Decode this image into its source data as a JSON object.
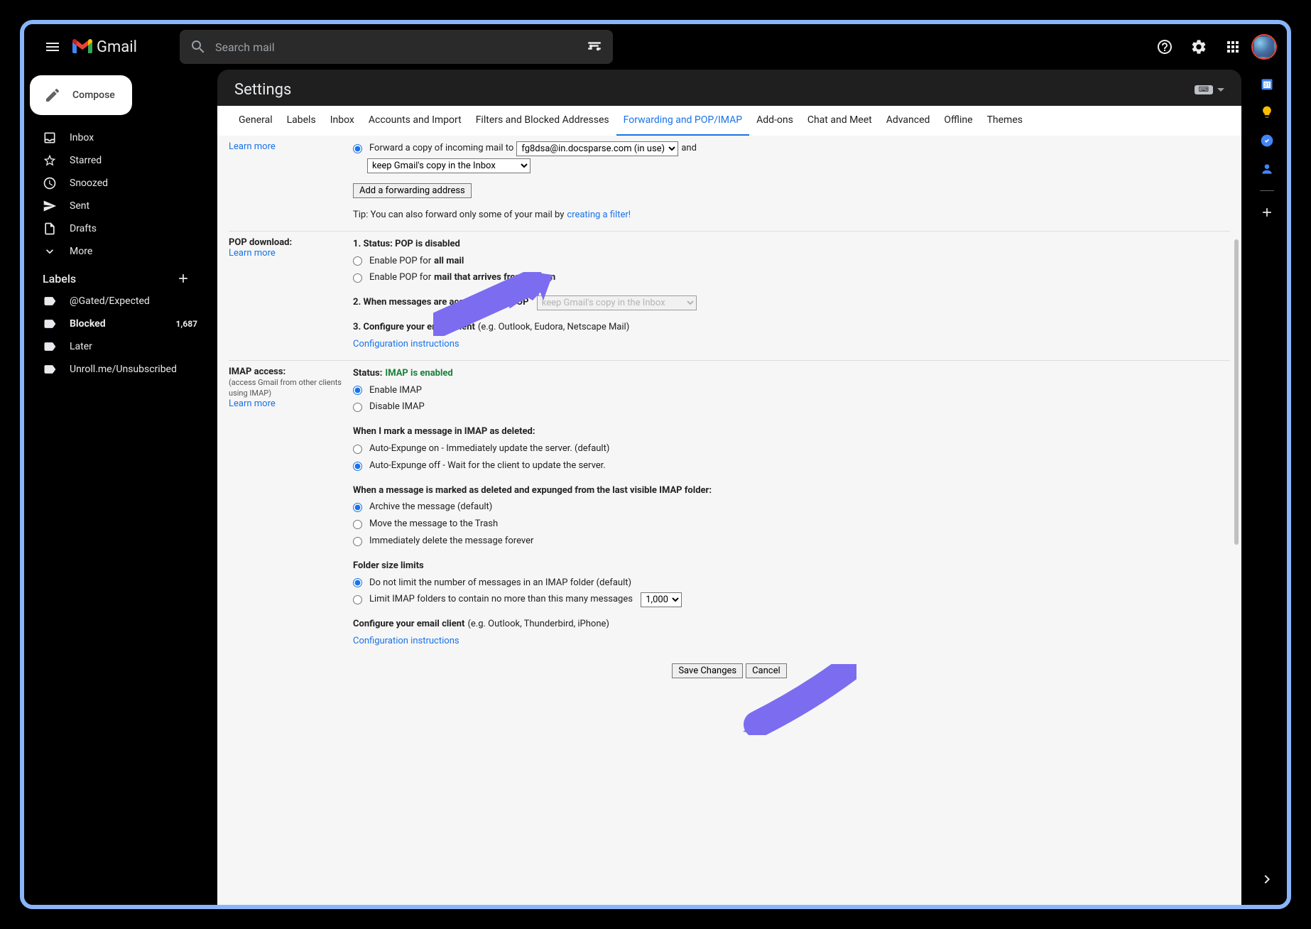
{
  "header": {
    "logo_text": "Gmail",
    "search_placeholder": "Search mail"
  },
  "sidebar": {
    "compose": "Compose",
    "items": [
      {
        "label": "Inbox"
      },
      {
        "label": "Starred"
      },
      {
        "label": "Snoozed"
      },
      {
        "label": "Sent"
      },
      {
        "label": "Drafts"
      },
      {
        "label": "More"
      }
    ],
    "labels_title": "Labels",
    "labels": [
      {
        "label": "@Gated/Expected",
        "bold": false,
        "count": ""
      },
      {
        "label": "Blocked",
        "bold": true,
        "count": "1,687"
      },
      {
        "label": "Later",
        "bold": false,
        "count": ""
      },
      {
        "label": "Unroll.me/Unsubscribed",
        "bold": false,
        "count": ""
      }
    ]
  },
  "settings": {
    "title": "Settings",
    "input_indicator": "⌨",
    "tabs": [
      "General",
      "Labels",
      "Inbox",
      "Accounts and Import",
      "Filters and Blocked Addresses",
      "Forwarding and POP/IMAP",
      "Add-ons",
      "Chat and Meet",
      "Advanced",
      "Offline",
      "Themes"
    ],
    "active_tab": "Forwarding and POP/IMAP"
  },
  "forwarding": {
    "learn_more": "Learn more",
    "radio_label": "Forward a copy of incoming mail to",
    "address": "fg8dsa@in.docsparse.com (in use)",
    "and": "and",
    "action": "keep Gmail's copy in the Inbox",
    "add_button": "Add a forwarding address",
    "tip_prefix": "Tip: You can also forward only some of your mail by ",
    "tip_link": "creating a filter!"
  },
  "pop": {
    "title": "POP download:",
    "learn_more": "Learn more",
    "status_prefix": "1. Status: ",
    "status": "POP is disabled",
    "enable_all_prefix": "Enable POP for ",
    "enable_all_bold": "all mail",
    "enable_now_prefix": "Enable POP for ",
    "enable_now_bold": "mail that arrives from now on",
    "access_title": "2. When messages are accessed with POP",
    "access_value": "keep Gmail's copy in the Inbox",
    "configure_title": "3. Configure your email client ",
    "configure_hint": "(e.g. Outlook, Eudora, Netscape Mail)",
    "config_link": "Configuration instructions"
  },
  "imap": {
    "title": "IMAP access:",
    "sub": "(access Gmail from other clients using IMAP)",
    "learn_more": "Learn more",
    "status_prefix": "Status: ",
    "status": "IMAP is enabled",
    "enable": "Enable IMAP",
    "disable": "Disable IMAP",
    "deleted_title": "When I mark a message in IMAP as deleted:",
    "expunge_on": "Auto-Expunge on - Immediately update the server. (default)",
    "expunge_off": "Auto-Expunge off - Wait for the client to update the server.",
    "expunged_title": "When a message is marked as deleted and expunged from the last visible IMAP folder:",
    "archive": "Archive the message (default)",
    "trash": "Move the message to the Trash",
    "delete": "Immediately delete the message forever",
    "limits_title": "Folder size limits",
    "no_limit": "Do not limit the number of messages in an IMAP folder (default)",
    "limit_prefix": "Limit IMAP folders to contain no more than this many messages",
    "limit_value": "1,000",
    "configure_title": "Configure your email client ",
    "configure_hint": "(e.g. Outlook, Thunderbird, iPhone)",
    "config_link": "Configuration instructions"
  },
  "buttons": {
    "save": "Save Changes",
    "cancel": "Cancel"
  }
}
